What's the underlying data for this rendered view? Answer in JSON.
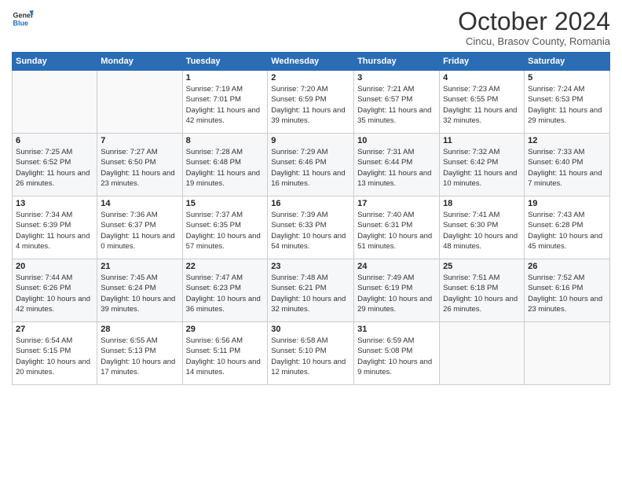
{
  "header": {
    "logo_line1": "General",
    "logo_line2": "Blue",
    "month_title": "October 2024",
    "subtitle": "Cincu, Brasov County, Romania"
  },
  "days_of_week": [
    "Sunday",
    "Monday",
    "Tuesday",
    "Wednesday",
    "Thursday",
    "Friday",
    "Saturday"
  ],
  "weeks": [
    [
      {
        "day": "",
        "info": ""
      },
      {
        "day": "",
        "info": ""
      },
      {
        "day": "1",
        "info": "Sunrise: 7:19 AM\nSunset: 7:01 PM\nDaylight: 11 hours and 42 minutes."
      },
      {
        "day": "2",
        "info": "Sunrise: 7:20 AM\nSunset: 6:59 PM\nDaylight: 11 hours and 39 minutes."
      },
      {
        "day": "3",
        "info": "Sunrise: 7:21 AM\nSunset: 6:57 PM\nDaylight: 11 hours and 35 minutes."
      },
      {
        "day": "4",
        "info": "Sunrise: 7:23 AM\nSunset: 6:55 PM\nDaylight: 11 hours and 32 minutes."
      },
      {
        "day": "5",
        "info": "Sunrise: 7:24 AM\nSunset: 6:53 PM\nDaylight: 11 hours and 29 minutes."
      }
    ],
    [
      {
        "day": "6",
        "info": "Sunrise: 7:25 AM\nSunset: 6:52 PM\nDaylight: 11 hours and 26 minutes."
      },
      {
        "day": "7",
        "info": "Sunrise: 7:27 AM\nSunset: 6:50 PM\nDaylight: 11 hours and 23 minutes."
      },
      {
        "day": "8",
        "info": "Sunrise: 7:28 AM\nSunset: 6:48 PM\nDaylight: 11 hours and 19 minutes."
      },
      {
        "day": "9",
        "info": "Sunrise: 7:29 AM\nSunset: 6:46 PM\nDaylight: 11 hours and 16 minutes."
      },
      {
        "day": "10",
        "info": "Sunrise: 7:31 AM\nSunset: 6:44 PM\nDaylight: 11 hours and 13 minutes."
      },
      {
        "day": "11",
        "info": "Sunrise: 7:32 AM\nSunset: 6:42 PM\nDaylight: 11 hours and 10 minutes."
      },
      {
        "day": "12",
        "info": "Sunrise: 7:33 AM\nSunset: 6:40 PM\nDaylight: 11 hours and 7 minutes."
      }
    ],
    [
      {
        "day": "13",
        "info": "Sunrise: 7:34 AM\nSunset: 6:39 PM\nDaylight: 11 hours and 4 minutes."
      },
      {
        "day": "14",
        "info": "Sunrise: 7:36 AM\nSunset: 6:37 PM\nDaylight: 11 hours and 0 minutes."
      },
      {
        "day": "15",
        "info": "Sunrise: 7:37 AM\nSunset: 6:35 PM\nDaylight: 10 hours and 57 minutes."
      },
      {
        "day": "16",
        "info": "Sunrise: 7:39 AM\nSunset: 6:33 PM\nDaylight: 10 hours and 54 minutes."
      },
      {
        "day": "17",
        "info": "Sunrise: 7:40 AM\nSunset: 6:31 PM\nDaylight: 10 hours and 51 minutes."
      },
      {
        "day": "18",
        "info": "Sunrise: 7:41 AM\nSunset: 6:30 PM\nDaylight: 10 hours and 48 minutes."
      },
      {
        "day": "19",
        "info": "Sunrise: 7:43 AM\nSunset: 6:28 PM\nDaylight: 10 hours and 45 minutes."
      }
    ],
    [
      {
        "day": "20",
        "info": "Sunrise: 7:44 AM\nSunset: 6:26 PM\nDaylight: 10 hours and 42 minutes."
      },
      {
        "day": "21",
        "info": "Sunrise: 7:45 AM\nSunset: 6:24 PM\nDaylight: 10 hours and 39 minutes."
      },
      {
        "day": "22",
        "info": "Sunrise: 7:47 AM\nSunset: 6:23 PM\nDaylight: 10 hours and 36 minutes."
      },
      {
        "day": "23",
        "info": "Sunrise: 7:48 AM\nSunset: 6:21 PM\nDaylight: 10 hours and 32 minutes."
      },
      {
        "day": "24",
        "info": "Sunrise: 7:49 AM\nSunset: 6:19 PM\nDaylight: 10 hours and 29 minutes."
      },
      {
        "day": "25",
        "info": "Sunrise: 7:51 AM\nSunset: 6:18 PM\nDaylight: 10 hours and 26 minutes."
      },
      {
        "day": "26",
        "info": "Sunrise: 7:52 AM\nSunset: 6:16 PM\nDaylight: 10 hours and 23 minutes."
      }
    ],
    [
      {
        "day": "27",
        "info": "Sunrise: 6:54 AM\nSunset: 5:15 PM\nDaylight: 10 hours and 20 minutes."
      },
      {
        "day": "28",
        "info": "Sunrise: 6:55 AM\nSunset: 5:13 PM\nDaylight: 10 hours and 17 minutes."
      },
      {
        "day": "29",
        "info": "Sunrise: 6:56 AM\nSunset: 5:11 PM\nDaylight: 10 hours and 14 minutes."
      },
      {
        "day": "30",
        "info": "Sunrise: 6:58 AM\nSunset: 5:10 PM\nDaylight: 10 hours and 12 minutes."
      },
      {
        "day": "31",
        "info": "Sunrise: 6:59 AM\nSunset: 5:08 PM\nDaylight: 10 hours and 9 minutes."
      },
      {
        "day": "",
        "info": ""
      },
      {
        "day": "",
        "info": ""
      }
    ]
  ]
}
